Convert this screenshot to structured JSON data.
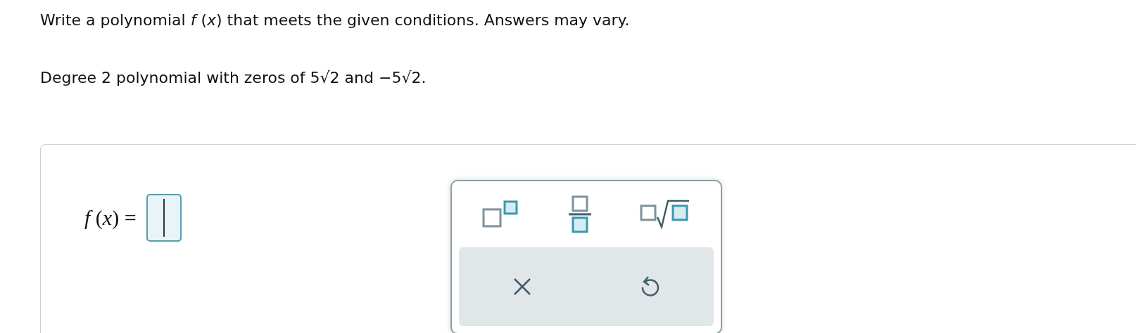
{
  "instructions": "Write a polynomial *f* (*x*) that meets the given conditions. Answers may vary.",
  "problem": "Degree 2 polynomial with zeros of 5√2 and −5√2.",
  "answer": {
    "label": "*f* (*x*) ="
  },
  "palette": {
    "tools": [
      {
        "kind": "exponent"
      },
      {
        "kind": "fraction"
      },
      {
        "kind": "root"
      }
    ],
    "actions": [
      {
        "kind": "clear"
      },
      {
        "kind": "undo"
      }
    ]
  }
}
